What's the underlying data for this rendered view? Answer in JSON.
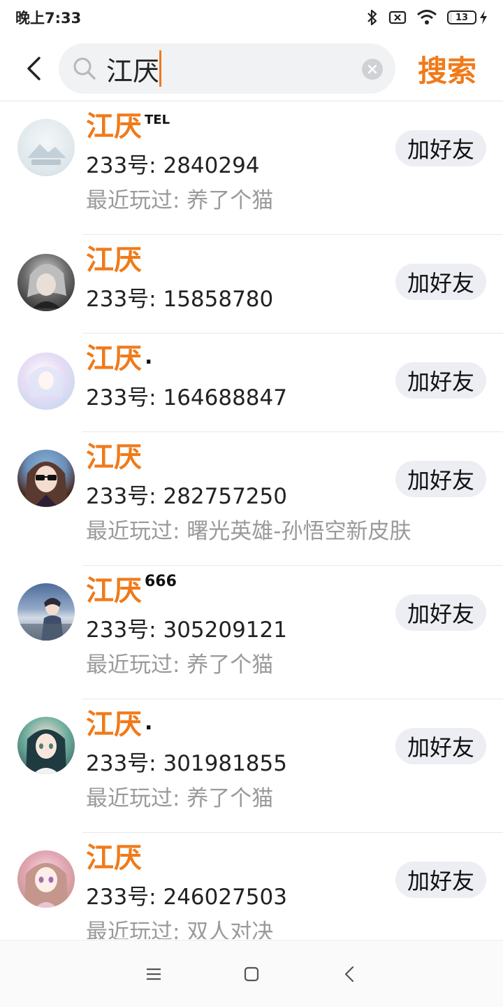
{
  "status_bar": {
    "time": "晚上7:33",
    "battery": "13",
    "battery_level": 0.13
  },
  "search": {
    "query": "江厌",
    "button_label": "搜索"
  },
  "results": [
    {
      "name": "江厌",
      "suffix": "TEL",
      "uid": "233号: 2840294",
      "played": "最近玩过: 养了个猫",
      "add_label": "加好友"
    },
    {
      "name": "江厌",
      "suffix": "",
      "uid": "233号: 15858780",
      "played": "",
      "add_label": "加好友"
    },
    {
      "name": "江厌",
      "suffix": ".",
      "uid": "233号: 164688847",
      "played": "",
      "add_label": "加好友"
    },
    {
      "name": "江厌",
      "suffix": "",
      "uid": "233号: 282757250",
      "played": "最近玩过: 曙光英雄-孙悟空新皮肤",
      "add_label": "加好友"
    },
    {
      "name": "江厌",
      "suffix": "666",
      "uid": "233号: 305209121",
      "played": "最近玩过: 养了个猫",
      "add_label": "加好友"
    },
    {
      "name": "江厌",
      "suffix": ".",
      "uid": "233号: 301981855",
      "played": "最近玩过: 养了个猫",
      "add_label": "加好友"
    },
    {
      "name": "江厌",
      "suffix": "",
      "uid": "233号: 246027503",
      "played": "最近玩过: 双人对决",
      "add_label": "加好友"
    }
  ],
  "avatar_icons": [
    "landscape-avatar-icon",
    "anime-gray-hair-avatar-icon",
    "anime-pastel-avatar-icon",
    "anime-sunglasses-avatar-icon",
    "anime-boy-sky-avatar-icon",
    "anime-green-hair-avatar-icon",
    "anime-pink-hair-avatar-icon"
  ],
  "colors": {
    "accent": "#f07a1a",
    "button_bg": "#eceef3",
    "search_bg": "#f1f2f4",
    "secondary_text": "#9a9a9a"
  }
}
